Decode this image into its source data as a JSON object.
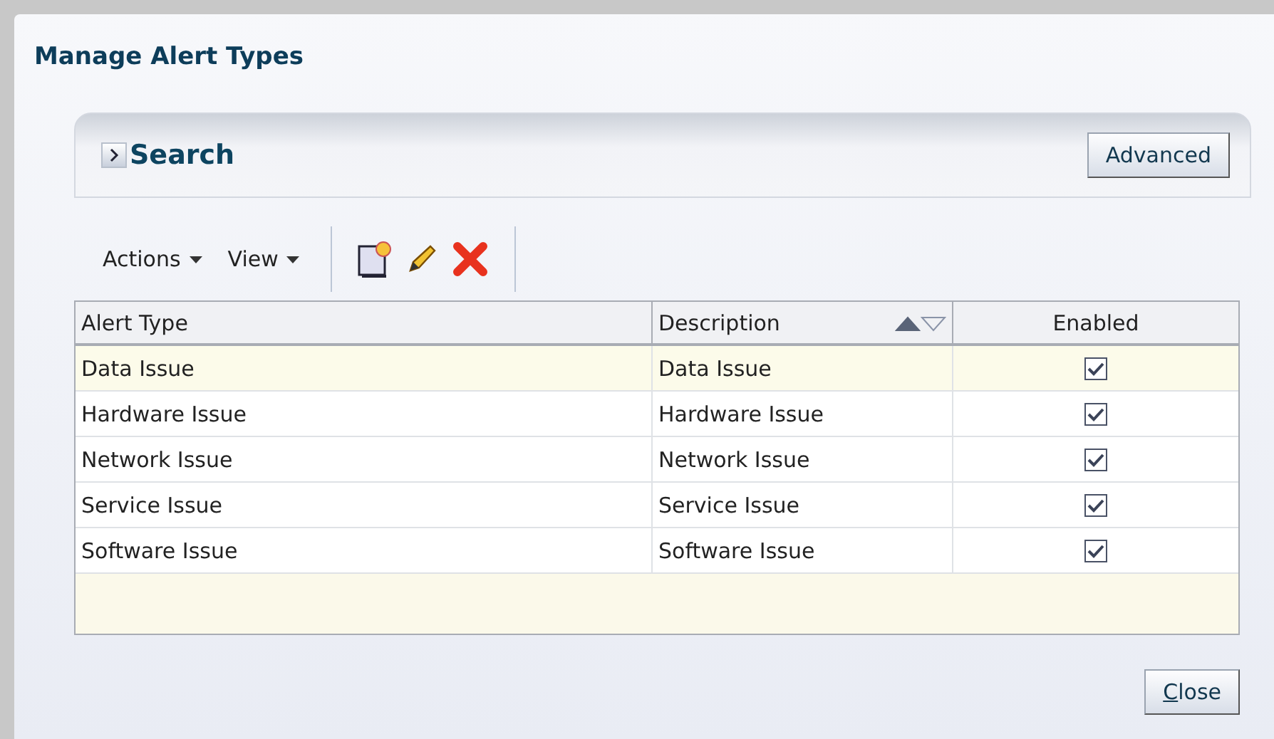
{
  "dialog": {
    "title": "Manage Alert Types"
  },
  "search": {
    "label": "Search",
    "expanded": false,
    "advanced_button": "Advanced"
  },
  "toolbar": {
    "menus": [
      "Actions",
      "View"
    ]
  },
  "table": {
    "columns": [
      {
        "label": "Alert Type",
        "sorted": false
      },
      {
        "label": "Description",
        "sorted": true
      },
      {
        "label": "Enabled",
        "sorted": false
      }
    ],
    "rows": [
      {
        "alert_type": "Data Issue",
        "description": "Data Issue",
        "enabled": true,
        "selected": true
      },
      {
        "alert_type": "Hardware Issue",
        "description": "Hardware Issue",
        "enabled": true,
        "selected": false
      },
      {
        "alert_type": "Network Issue",
        "description": "Network Issue",
        "enabled": true,
        "selected": false
      },
      {
        "alert_type": "Service Issue",
        "description": "Service Issue",
        "enabled": true,
        "selected": false
      },
      {
        "alert_type": "Software Issue",
        "description": "Software Issue",
        "enabled": true,
        "selected": false
      }
    ]
  },
  "close_button": "Close"
}
